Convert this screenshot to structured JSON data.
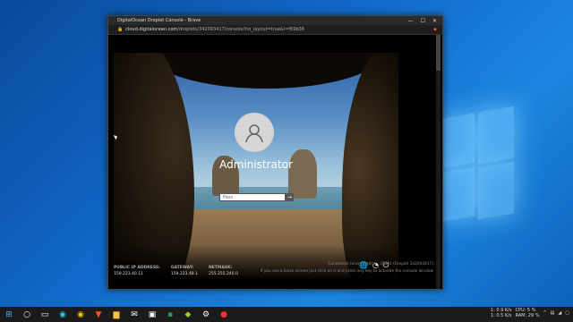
{
  "browser": {
    "title": "DigitalOcean Droplet Console - Brave",
    "url_host": "cloud.digitalocean.com",
    "url_path": "/droplets/342093417/console?no_layout=true&i=f69b36"
  },
  "lockscreen": {
    "username": "Administrator",
    "password_placeholder": "Pass"
  },
  "network": {
    "public_ip_label": "PUBLIC IP ADDRESS:",
    "public_ip": "159.223.40.11",
    "gateway_label": "GATEWAY:",
    "gateway": "159.223.48.1",
    "netmask_label": "NETMASK:",
    "netmask": "255.255.240.0"
  },
  "console_hint": {
    "status": "Connected (encrypted) to: QEMU (Droplet 342093417)",
    "message": "If you see a black screen just click on it and press any key to activate the console window"
  },
  "taskbar": {
    "net_up": "1: 0.9 K/s",
    "net_down": "1: 0.5 K/s",
    "cpu": "CPU: 5 %",
    "ram": "RAM: 29 %"
  },
  "icons": [
    "globe-icon",
    "accessibility-icon",
    "power-icon"
  ],
  "colors": {
    "desktop": "#1268c9",
    "taskbar": "#1b1b1b"
  }
}
